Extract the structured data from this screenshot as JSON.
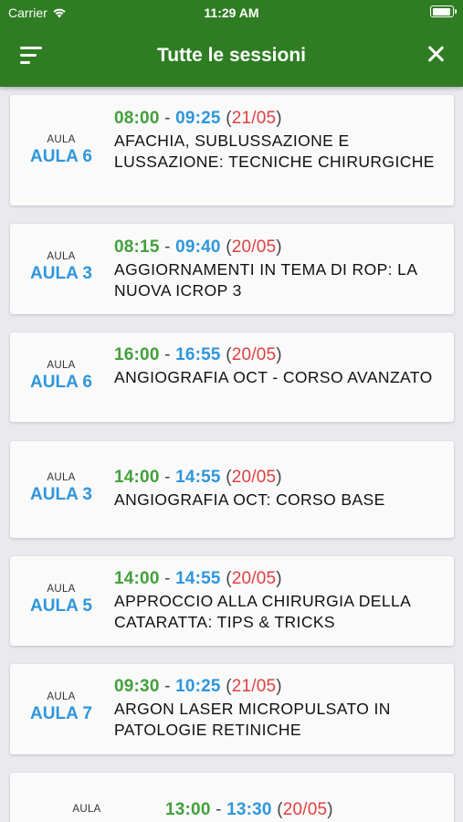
{
  "status_bar": {
    "carrier": "Carrier",
    "time": "11:29 AM"
  },
  "header": {
    "title": "Tutte le sessioni",
    "menu_icon": "filter-menu-icon",
    "close_icon": "close-icon"
  },
  "colors": {
    "header_bg": "#2f7d23",
    "start_time": "#43a03c",
    "end_time": "#2f96dc",
    "date": "#e04040",
    "room": "#2f96dc"
  },
  "sessions": [
    {
      "room_label": "AULA",
      "room": "AULA 6",
      "start": "08:00",
      "end": "09:25",
      "date": "21/05",
      "title": "AFACHIA, SUBLUSSAZIONE E LUSSAZIONE: TECNICHE CHIRURGICHE"
    },
    {
      "room_label": "AULA",
      "room": "AULA 3",
      "start": "08:15",
      "end": "09:40",
      "date": "20/05",
      "title": "AGGIORNAMENTI IN TEMA DI ROP: LA NUOVA ICROP 3"
    },
    {
      "room_label": "AULA",
      "room": "AULA 6",
      "start": "16:00",
      "end": "16:55",
      "date": "20/05",
      "title": "ANGIOGRAFIA OCT - CORSO AVANZATO"
    },
    {
      "room_label": "AULA",
      "room": "AULA 3",
      "start": "14:00",
      "end": "14:55",
      "date": "20/05",
      "title": "ANGIOGRAFIA OCT: CORSO BASE"
    },
    {
      "room_label": "AULA",
      "room": "AULA 5",
      "start": "14:00",
      "end": "14:55",
      "date": "20/05",
      "title": "APPROCCIO ALLA CHIRURGIA DELLA CATARATTA: TIPS & TRICKS"
    },
    {
      "room_label": "AULA",
      "room": "AULA 7",
      "start": "09:30",
      "end": "10:25",
      "date": "21/05",
      "title": "ARGON LASER MICROPULSATO IN PATOLOGIE RETINICHE"
    },
    {
      "room_label": "AULA",
      "room": "",
      "start": "13:00",
      "end": "13:30",
      "date": "20/05",
      "title": ""
    }
  ]
}
